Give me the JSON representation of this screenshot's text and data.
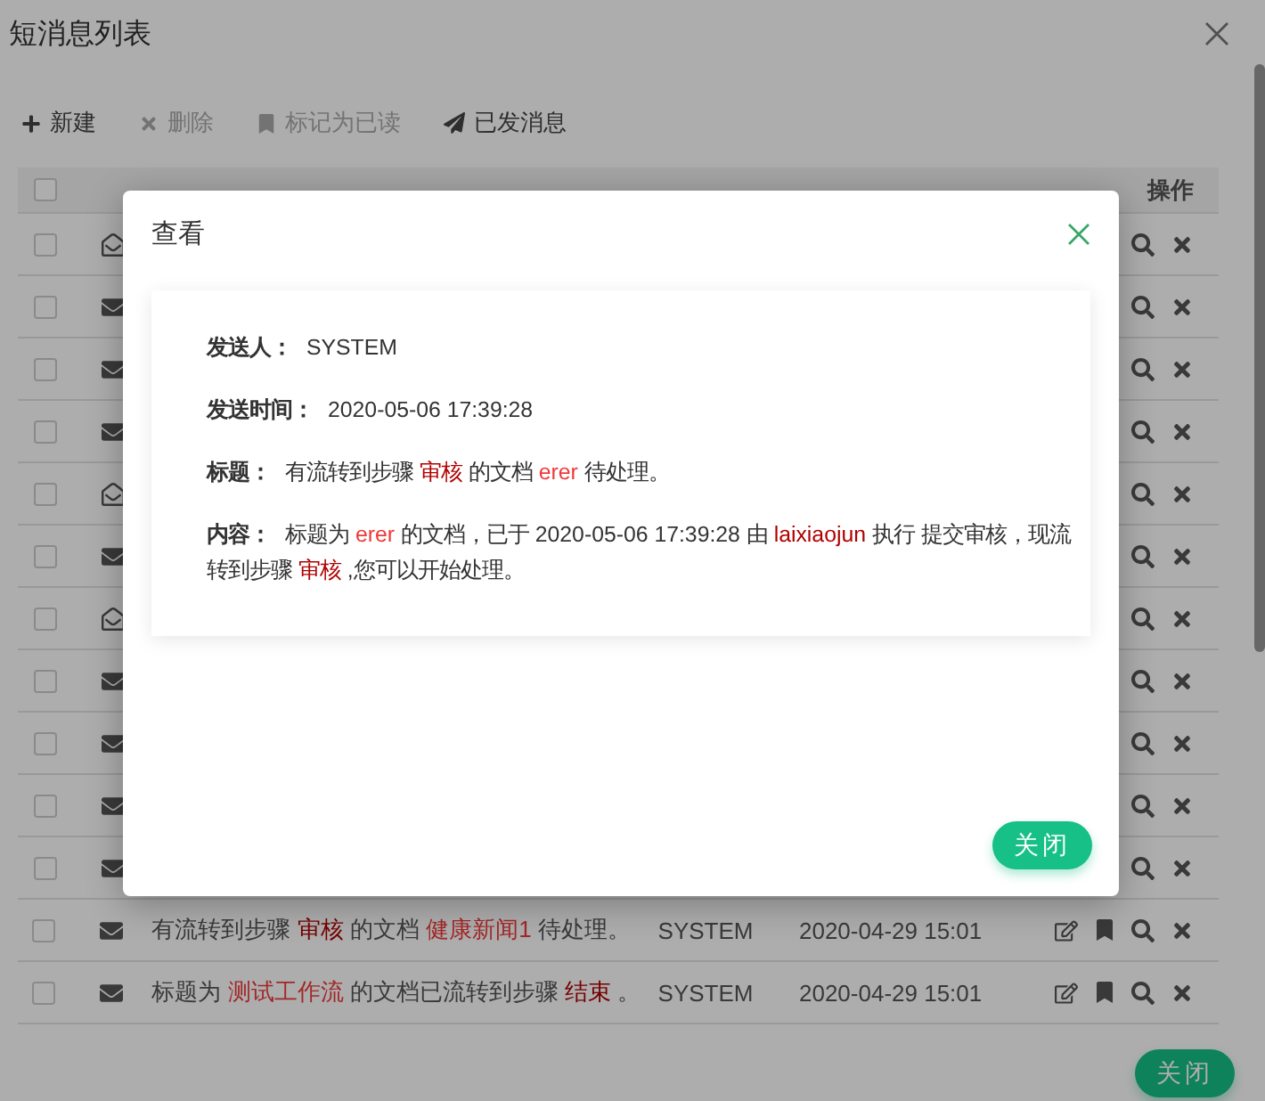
{
  "window": {
    "title": "短消息列表"
  },
  "toolbar": [
    {
      "kind": "new",
      "label": "新建",
      "disabled": false
    },
    {
      "kind": "delete",
      "label": "删除",
      "disabled": true
    },
    {
      "kind": "mark",
      "label": "标记为已读",
      "disabled": true
    },
    {
      "kind": "sent",
      "label": "已发消息",
      "disabled": false
    }
  ],
  "table": {
    "select_all": {
      "checked": false
    },
    "actions_column": "操作",
    "rows": [
      {
        "checked": false,
        "read": true,
        "actions": [
          {
            "kind": "view"
          },
          {
            "kind": "delete"
          }
        ]
      },
      {
        "checked": false,
        "read": false,
        "actions": [
          {
            "kind": "view"
          },
          {
            "kind": "delete"
          }
        ]
      },
      {
        "checked": false,
        "read": false,
        "actions": [
          {
            "kind": "view"
          },
          {
            "kind": "delete"
          }
        ]
      },
      {
        "checked": false,
        "read": false,
        "actions": [
          {
            "kind": "view"
          },
          {
            "kind": "delete"
          }
        ]
      },
      {
        "checked": false,
        "read": true,
        "actions": [
          {
            "kind": "view"
          },
          {
            "kind": "delete"
          }
        ]
      },
      {
        "checked": false,
        "read": false,
        "actions": [
          {
            "kind": "view"
          },
          {
            "kind": "delete"
          }
        ]
      },
      {
        "checked": false,
        "read": true,
        "actions": [
          {
            "kind": "view"
          },
          {
            "kind": "delete"
          }
        ]
      },
      {
        "checked": false,
        "read": false,
        "actions": [
          {
            "kind": "view"
          },
          {
            "kind": "delete"
          }
        ]
      },
      {
        "checked": false,
        "read": false,
        "actions": [
          {
            "kind": "view"
          },
          {
            "kind": "delete"
          }
        ]
      },
      {
        "checked": false,
        "read": false,
        "actions": [
          {
            "kind": "view"
          },
          {
            "kind": "delete"
          }
        ]
      },
      {
        "checked": false,
        "read": false,
        "actions": [
          {
            "kind": "view"
          },
          {
            "kind": "delete"
          }
        ]
      },
      {
        "checked": false,
        "read": false,
        "title": [
          {
            "kind": "plain",
            "text": "有流转到步骤 "
          },
          {
            "kind": "step",
            "text": "审核"
          },
          {
            "kind": "plain",
            "text": " 的文档 "
          },
          {
            "kind": "doc",
            "text": "健康新闻1"
          },
          {
            "kind": "plain",
            "text": " 待处理。"
          }
        ],
        "sender": "SYSTEM",
        "time": "2020-04-29 15:01",
        "actions": [
          {
            "kind": "edit"
          },
          {
            "kind": "bookmark"
          },
          {
            "kind": "view"
          },
          {
            "kind": "delete"
          }
        ]
      },
      {
        "checked": false,
        "read": false,
        "title": [
          {
            "kind": "plain",
            "text": "标题为 "
          },
          {
            "kind": "doc",
            "text": "测试工作流"
          },
          {
            "kind": "plain",
            "text": " 的文档已流转到步骤 "
          },
          {
            "kind": "step",
            "text": "结束"
          },
          {
            "kind": "plain",
            "text": " 。"
          }
        ],
        "sender": "SYSTEM",
        "time": "2020-04-29 15:01",
        "actions": [
          {
            "kind": "edit"
          },
          {
            "kind": "bookmark"
          },
          {
            "kind": "view"
          },
          {
            "kind": "delete"
          }
        ]
      }
    ]
  },
  "close_button": "关闭",
  "dialog": {
    "title": "查看",
    "fields": [
      {
        "label": "发送人：",
        "value": [
          {
            "kind": "plain",
            "text": "SYSTEM"
          }
        ]
      },
      {
        "label": "发送时间：",
        "value": [
          {
            "kind": "plain",
            "text": "2020-05-06 17:39:28"
          }
        ]
      },
      {
        "label": "标题：",
        "value": [
          {
            "kind": "plain",
            "text": "有流转到步骤 "
          },
          {
            "kind": "step",
            "text": "审核"
          },
          {
            "kind": "plain",
            "text": " 的文档 "
          },
          {
            "kind": "doc",
            "text": "erer"
          },
          {
            "kind": "plain",
            "text": " 待处理。"
          }
        ]
      },
      {
        "label": "内容：",
        "value": [
          {
            "kind": "plain",
            "text": "标题为 "
          },
          {
            "kind": "doc",
            "text": "erer"
          },
          {
            "kind": "plain",
            "text": " 的文档，已于 2020-05-06 17:39:28 由 "
          },
          {
            "kind": "step",
            "text": "laixiaojun"
          },
          {
            "kind": "plain",
            "text": " 执行 提交审核，现流转到步骤 "
          },
          {
            "kind": "step",
            "text": "审核"
          },
          {
            "kind": "plain",
            "text": " ,您可以开始处理。"
          }
        ]
      }
    ],
    "close_button": "关闭"
  }
}
